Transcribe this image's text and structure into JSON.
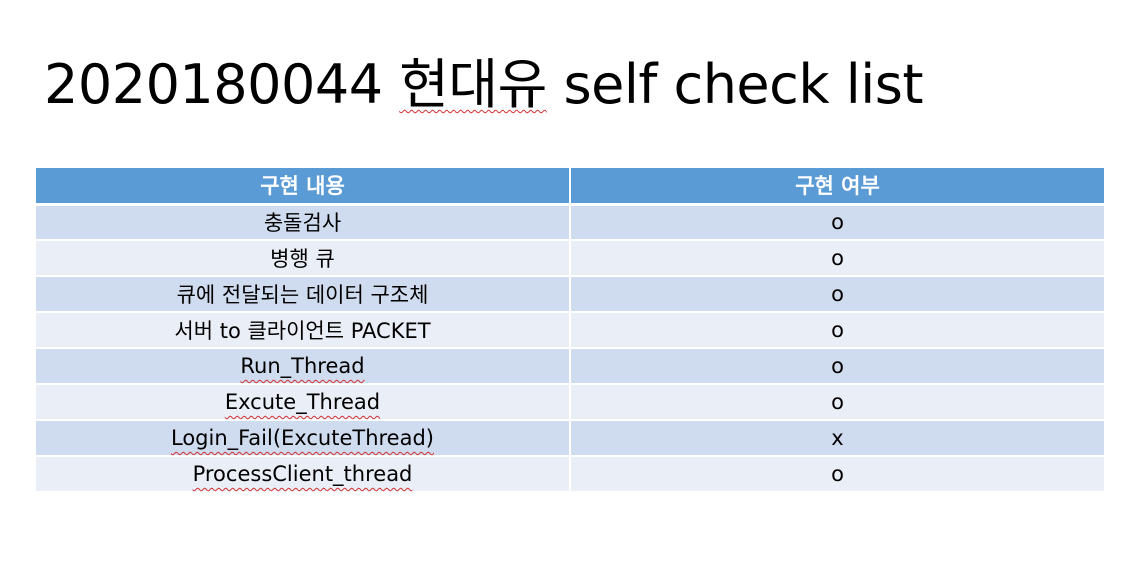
{
  "title": {
    "number": "2020180044",
    "name": "현대유",
    "suffix": "self check list"
  },
  "table": {
    "headers": [
      "구현 내용",
      "구현 여부"
    ],
    "rows": [
      {
        "item": "충돌검사",
        "status": "o"
      },
      {
        "item": "병행 큐",
        "status": "o"
      },
      {
        "item": "큐에 전달되는 데이터 구조체",
        "status": "o"
      },
      {
        "item": "서버 to 클라이언트 PACKET",
        "status": "o"
      },
      {
        "item": "Run_Thread",
        "status": "o"
      },
      {
        "item": "Excute_Thread",
        "status": "o"
      },
      {
        "item": "Login_Fail(ExcuteThread)",
        "status": "x"
      },
      {
        "item": "ProcessClient_thread",
        "status": "o"
      }
    ]
  },
  "colors": {
    "header": "#5b9bd5",
    "row_dark": "#cfdbee",
    "row_light": "#e9eef7",
    "spellcheck_underline": "#d32f2f"
  }
}
